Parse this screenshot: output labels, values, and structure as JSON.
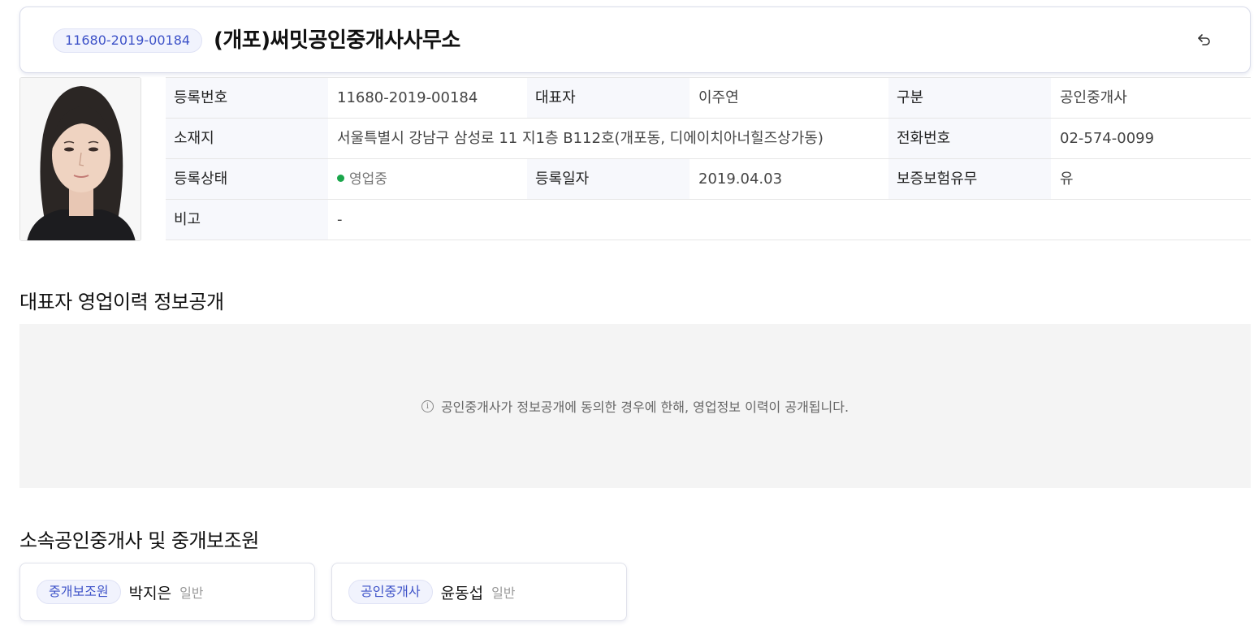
{
  "header": {
    "reg_badge": "11680-2019-00184",
    "office_name": "(개포)써밋공인중개사사무소"
  },
  "info": {
    "rows": [
      {
        "label1": "등록번호",
        "value1": "11680-2019-00184",
        "label2": "대표자",
        "value2": "이주연",
        "label3": "구분",
        "value3": "공인중개사"
      },
      {
        "label1": "소재지",
        "value1": "서울특별시 강남구 삼성로 11 지1층 B112호(개포동, 디에이치아너힐즈상가동)",
        "label3": "전화번호",
        "value3": "02-574-0099"
      },
      {
        "label1": "등록상태",
        "value1": "영업중",
        "label2": "등록일자",
        "value2": "2019.04.03",
        "label3": "보증보험유무",
        "value3": "유"
      },
      {
        "label1": "비고",
        "value1": "-"
      }
    ],
    "status_color": "#1aa64b"
  },
  "history": {
    "title": "대표자 영업이력 정보공개",
    "notice_icon": "info-icon",
    "notice": "공인중개사가 정보공개에 동의한 경우에 한해, 영업정보 이력이 공개됩니다."
  },
  "members": {
    "title": "소속공인중개사 및 중개보조원",
    "items": [
      {
        "role": "중개보조원",
        "name": "박지은",
        "type": "일반"
      },
      {
        "role": "공인중개사",
        "name": "윤동섭",
        "type": "일반"
      }
    ]
  },
  "colors": {
    "accent": "#3d52c8",
    "badge_bg": "#f1f3fd",
    "label_bg": "#f7f8fc"
  }
}
